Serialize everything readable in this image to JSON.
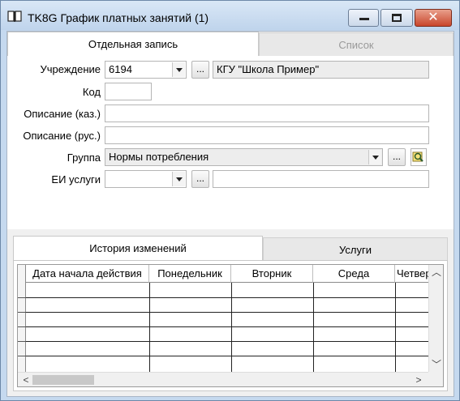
{
  "window": {
    "title": "TK8G График платных занятий (1)",
    "icons": {
      "app": "book-icon",
      "minimize": "minimize-icon",
      "maximize": "maximize-icon",
      "close": "close-icon"
    }
  },
  "top_tabs": [
    {
      "label": "Отдельная запись",
      "active": true
    },
    {
      "label": "Список",
      "active": false
    }
  ],
  "form": {
    "institution": {
      "label": "Учреждение",
      "code": "6194",
      "name": "КГУ \"Школа Пример\""
    },
    "code": {
      "label": "Код",
      "value": ""
    },
    "desc_kaz": {
      "label": "Описание (каз.)",
      "value": ""
    },
    "desc_rus": {
      "label": "Описание (рус.)",
      "value": ""
    },
    "group": {
      "label": "Группа",
      "value": "Нормы потребления"
    },
    "unit": {
      "label": "ЕИ услуги",
      "value": "",
      "extra": ""
    },
    "dots_label": "..."
  },
  "bottom_tabs": [
    {
      "label": "История изменений",
      "active": true
    },
    {
      "label": "Услуги",
      "active": false
    }
  ],
  "grid": {
    "columns": [
      "Дата начала действия",
      "Понедельник",
      "Вторник",
      "Среда",
      "Четверг"
    ],
    "rows": [
      [
        "",
        "",
        "",
        "",
        ""
      ],
      [
        "",
        "",
        "",
        "",
        ""
      ],
      [
        "",
        "",
        "",
        "",
        ""
      ],
      [
        "",
        "",
        "",
        "",
        ""
      ],
      [
        "",
        "",
        "",
        "",
        ""
      ]
    ]
  },
  "colors": {
    "titlebar": "#c5d9ef",
    "close_button": "#c9462c",
    "panel": "#ffffff",
    "inactive_tab": "#e8e8e8"
  }
}
